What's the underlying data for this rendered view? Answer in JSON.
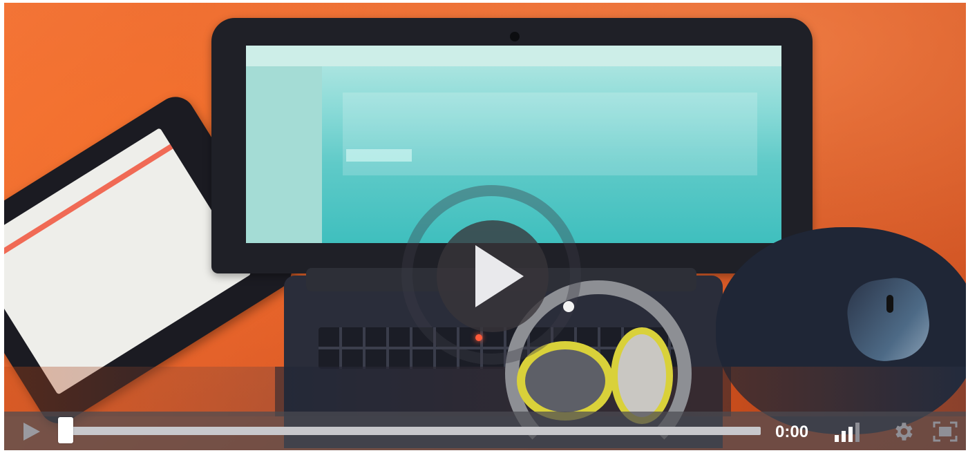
{
  "player": {
    "time": "0:00",
    "progress_fraction": 0.0,
    "controls": {
      "play_icon": "play-icon",
      "quality_icon": "signal-bars-icon",
      "settings_icon": "gear-icon",
      "fullscreen_icon": "fullscreen-icon"
    },
    "overlay": {
      "big_play_icon": "play-icon"
    }
  },
  "colors": {
    "control_bar": "#4b4b52",
    "progress_track": "#c8c8cc",
    "scrubber": "#ffffff",
    "desk_orange": "#e2602a"
  }
}
